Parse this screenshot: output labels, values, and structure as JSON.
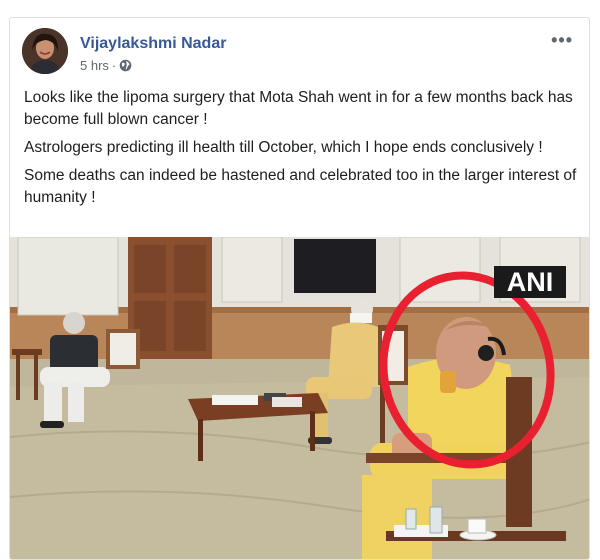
{
  "post": {
    "author": "Vijaylakshmi Nadar",
    "time": "5 hrs",
    "separator": "·",
    "privacy_icon": "globe-icon",
    "more_label": "•••",
    "paragraphs": [
      "Looks like the lipoma surgery that Mota Shah went in for a few months back has become full blown cancer !",
      "Astrologers predicting ill health till October, which I hope ends conclusively !",
      "Some deaths can indeed be hastened and celebrated too in the larger interest of humanity !"
    ],
    "image": {
      "watermark": "ANI",
      "highlight_color": "#e8202f"
    }
  },
  "colors": {
    "author_link": "#385898",
    "meta_text": "#606770"
  }
}
